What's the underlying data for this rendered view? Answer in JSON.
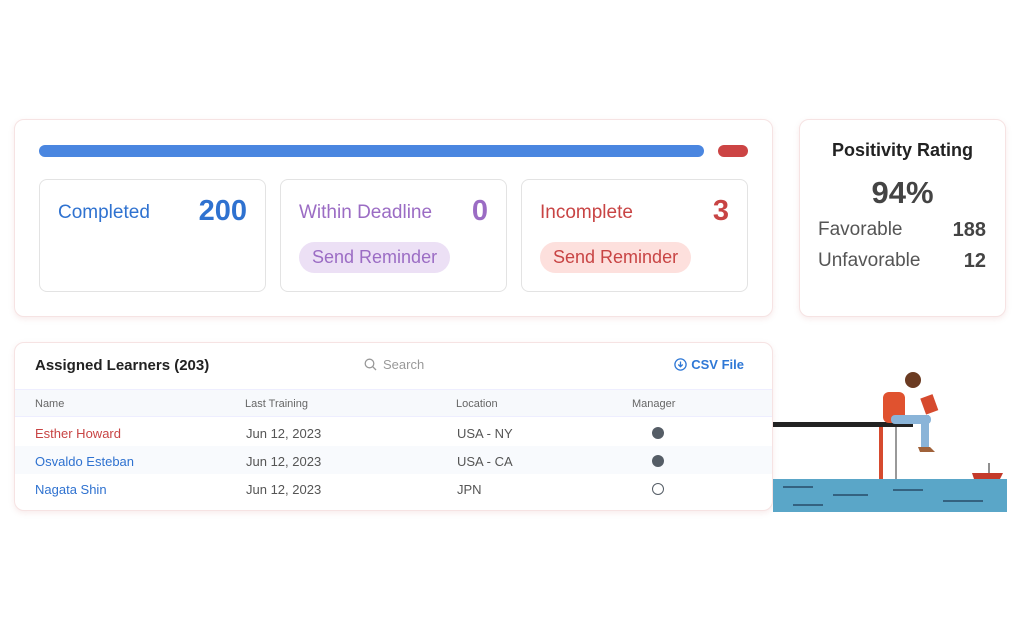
{
  "progress": {
    "completed": 200,
    "incomplete": 3,
    "total": 203,
    "colors": {
      "completed": "#4a86e0",
      "incomplete": "#cc4444"
    }
  },
  "stats": [
    {
      "label": "Completed",
      "value": "200",
      "color": "#2f72d0"
    },
    {
      "label": "Within Deadline",
      "value": "0",
      "color": "#9b6cc4",
      "button": "Send Reminder",
      "button_bg": "#ece0f5"
    },
    {
      "label": "Incomplete",
      "value": "3",
      "color": "#c84444",
      "button": "Send Reminder",
      "button_bg": "#fde0dd"
    }
  ],
  "rating": {
    "title": "Positivity Rating",
    "percent": "94%",
    "favorable_label": "Favorable",
    "favorable": "188",
    "unfavorable_label": "Unfavorable",
    "unfavorable": "12"
  },
  "table": {
    "title": "Assigned Learners (203)",
    "search_placeholder": "Search",
    "csv_label": "CSV File",
    "columns": [
      "Name",
      "Last Training",
      "Location",
      "Manager"
    ],
    "rows": [
      {
        "name": "Esther Howard",
        "date": "Jun 12, 2023",
        "location": "USA - NY",
        "manager": true,
        "name_color": "#c84444"
      },
      {
        "name": "Osvaldo Esteban",
        "date": "Jun 12, 2023",
        "location": "USA - CA",
        "manager": true,
        "name_color": "#2f72d0"
      },
      {
        "name": "Nagata Shin",
        "date": "Jun 12, 2023",
        "location": "JPN",
        "manager": false,
        "name_color": "#2f72d0"
      }
    ]
  }
}
